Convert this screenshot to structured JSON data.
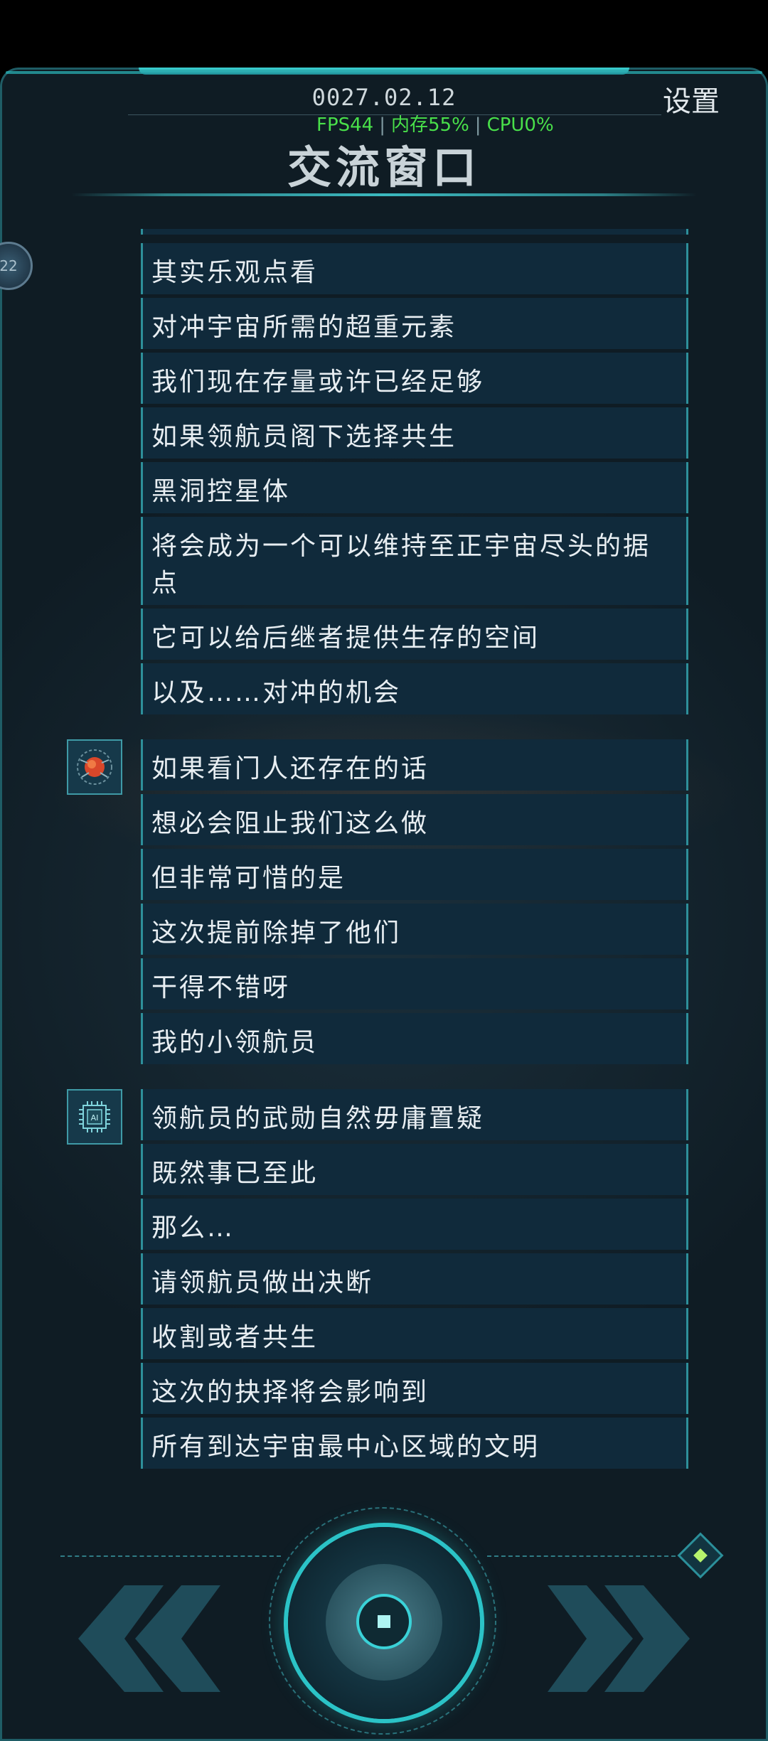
{
  "header": {
    "datetime": "0027.02.12",
    "settings_label": "设置",
    "perf": {
      "fps": "FPS44",
      "mem": "内存55%",
      "cpu": "CPU0%"
    },
    "title": "交流窗口"
  },
  "side_avatar": {
    "label": "22"
  },
  "groups": [
    {
      "speaker_icon": "nebula-avatar-icon",
      "messages": [
        "其实乐观点看",
        "对冲宇宙所需的超重元素",
        "我们现在存量或许已经足够",
        "如果领航员阁下选择共生",
        "黑洞控星体",
        "将会成为一个可以维持至正宇宙尽头的据点",
        "它可以给后继者提供生存的空间",
        "以及……对冲的机会"
      ]
    },
    {
      "speaker_icon": "red-nebula-avatar-icon",
      "messages": [
        "如果看门人还存在的话",
        "想必会阻止我们这么做",
        "但非常可惜的是",
        "这次提前除掉了他们",
        "干得不错呀",
        "我的小领航员"
      ]
    },
    {
      "speaker_icon": "ai-chip-avatar-icon",
      "speaker_label": "AI",
      "messages": [
        "领航员的武勋自然毋庸置疑",
        "既然事已至此",
        "那么…",
        "请领航员做出决断",
        "收割或者共生",
        "这次的抉择将会影响到",
        "所有到达宇宙最中心区域的文明"
      ]
    }
  ],
  "controls": {
    "prev_icon": "double-chevron-left-icon",
    "center_icon": "stop-square-icon",
    "next_icon": "double-chevron-right-icon",
    "gem_icon": "diamond-gem-icon"
  },
  "colors": {
    "accent": "#2bc3c7",
    "bubble": "#102a3b",
    "perf": "#49e04a"
  }
}
